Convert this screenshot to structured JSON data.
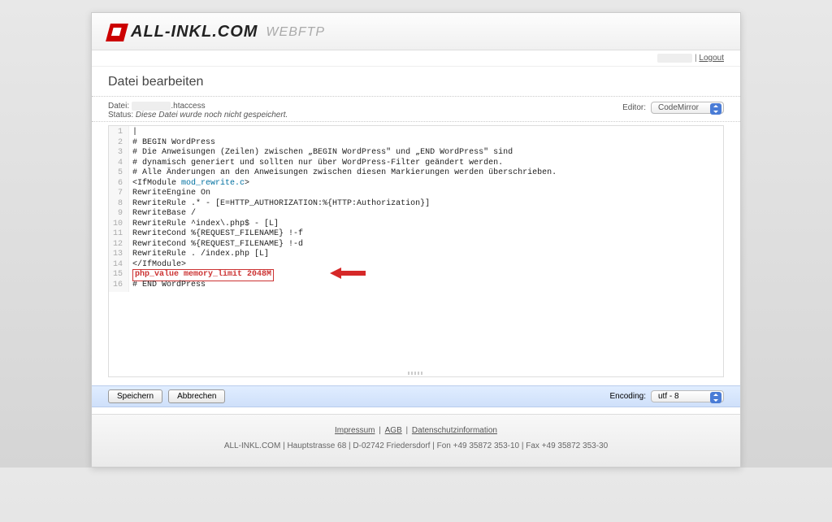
{
  "header": {
    "brand": "ALL-INKL.COM",
    "subbrand": "WEBFTP"
  },
  "topbar": {
    "user_obscured": "—",
    "separator": " | ",
    "logout": "Logout"
  },
  "title": "Datei bearbeiten",
  "meta": {
    "file_label": "Datei:",
    "file_obscured": "—",
    "file_suffix": ".htaccess",
    "status_label": "Status:",
    "status_text": "Diese Datei wurde noch nicht gespeichert.",
    "editor_label": "Editor:",
    "editor_selected": "CodeMirror"
  },
  "code": {
    "lines": [
      "|",
      "# BEGIN WordPress",
      "# Die Anweisungen (Zeilen) zwischen „BEGIN WordPress\" und „END WordPress\" sind",
      "# dynamisch generiert und sollten nur über WordPress-Filter geändert werden.",
      "# Alle Änderungen an den Anweisungen zwischen diesen Markierungen werden überschrieben.",
      "<IfModule mod_rewrite.c>",
      "RewriteEngine On",
      "RewriteRule .* - [E=HTTP_AUTHORIZATION:%{HTTP:Authorization}]",
      "RewriteBase /",
      "RewriteRule ^index\\.php$ - [L]",
      "RewriteCond %{REQUEST_FILENAME} !-f",
      "RewriteCond %{REQUEST_FILENAME} !-d",
      "RewriteRule . /index.php [L]",
      "</IfModule>",
      "php_value memory_limit 2048M",
      "# END WordPress"
    ],
    "highlight_line_index": 14,
    "keyword_line_index": 5,
    "keyword_text": "mod_rewrite.c"
  },
  "actions": {
    "save": "Speichern",
    "cancel": "Abbrechen",
    "encoding_label": "Encoding:",
    "encoding_selected": "utf - 8"
  },
  "footer": {
    "links": [
      "Impressum",
      "AGB",
      "Datenschutzinformation"
    ],
    "address": "ALL-INKL.COM | Hauptstrasse 68 | D-02742 Friedersdorf | Fon +49 35872 353-10 | Fax +49 35872 353-30"
  },
  "colors": {
    "accent_red": "#c00",
    "annotation_red": "#d62828",
    "bar_blue": "#d6e6fb"
  }
}
